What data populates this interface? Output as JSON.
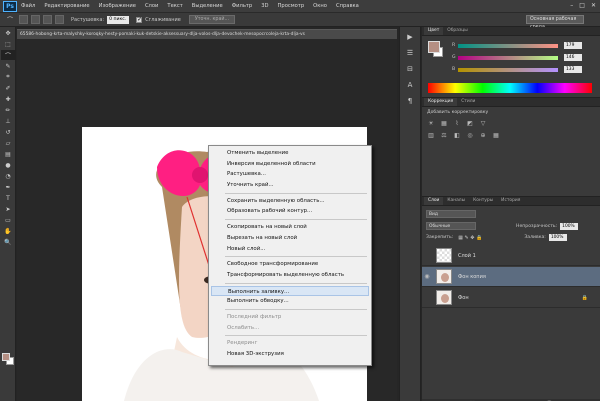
{
  "app": {
    "logo": "Ps"
  },
  "menubar": {
    "items": [
      "Файл",
      "Редактирование",
      "Изображение",
      "Слои",
      "Текст",
      "Выделение",
      "Фильтр",
      "3D",
      "Просмотр",
      "Окно",
      "Справка"
    ],
    "controls": [
      "–",
      "□",
      "✕"
    ]
  },
  "options": {
    "feather_label": "Растушевка:",
    "feather_value": "0 пикс.",
    "antialias_label": "Сглаживание",
    "refine_label": "Уточн. край...",
    "workspace": "Основная рабочая среда"
  },
  "document": {
    "tab_title": "65586-hobong-krta-malyshky-koroqky-hesty-pomaki-kuk-detskie-aksessuary-dlja-volos-dlja-devochek-mesopocrcoleja-krta-dlja-vs"
  },
  "context_menu": {
    "items": [
      {
        "label": "Отменить выделение",
        "disabled": false
      },
      {
        "label": "Инверсия выделенной области",
        "disabled": false
      },
      {
        "label": "Растушевка...",
        "disabled": false
      },
      {
        "label": "Уточнить край...",
        "disabled": false
      },
      {
        "sep": true
      },
      {
        "label": "Сохранить выделенную область...",
        "disabled": false
      },
      {
        "label": "Образовать рабочий контур...",
        "disabled": false
      },
      {
        "sep": true
      },
      {
        "label": "Скопировать на новый слой",
        "disabled": false
      },
      {
        "label": "Вырезать на новый слой",
        "disabled": false
      },
      {
        "label": "Новый слой...",
        "disabled": false
      },
      {
        "sep": true
      },
      {
        "label": "Свободное трансформирование",
        "disabled": false
      },
      {
        "label": "Трансформировать выделенную область",
        "disabled": false
      },
      {
        "sep": true
      },
      {
        "label": "Выполнить заливку...",
        "disabled": false,
        "highlight": true
      },
      {
        "label": "Выполнить обводку...",
        "disabled": false
      },
      {
        "sep": true
      },
      {
        "label": "Последний фильтр",
        "disabled": true
      },
      {
        "label": "Ослабить...",
        "disabled": true
      },
      {
        "sep": true
      },
      {
        "label": "Рендеринг",
        "disabled": true
      },
      {
        "label": "Новая 3D-экструзия",
        "disabled": false
      }
    ]
  },
  "color_panel": {
    "tabs": [
      "Цвет",
      "Образцы"
    ],
    "r_label": "R",
    "g_label": "G",
    "b_label": "B",
    "r_value": "179",
    "g_value": "146",
    "b_value": "133",
    "fg_color": "#b58f83"
  },
  "adjustments_panel": {
    "tabs": [
      "Коррекция",
      "Стили"
    ],
    "title": "Добавить корректировку"
  },
  "layers_panel": {
    "tabs": [
      "Слои",
      "Каналы",
      "Контуры",
      "История"
    ],
    "kind_label": "Вид",
    "blend_mode": "Обычные",
    "opacity_label": "Непрозрачность:",
    "opacity_value": "100%",
    "lock_label": "Закрепить:",
    "fill_label": "Заливка:",
    "fill_value": "100%",
    "layers": [
      {
        "name": "Слой 1",
        "visible": false,
        "thumb": "transparent",
        "selected": false,
        "locked": false
      },
      {
        "name": "Фон копия",
        "visible": true,
        "thumb": "image",
        "selected": true,
        "locked": false
      },
      {
        "name": "Фон",
        "visible": false,
        "thumb": "image",
        "selected": false,
        "locked": true
      }
    ],
    "footer_icons": [
      "⛓",
      "fx",
      "◐",
      "◑",
      "▭",
      "⊞",
      "🗑"
    ]
  }
}
